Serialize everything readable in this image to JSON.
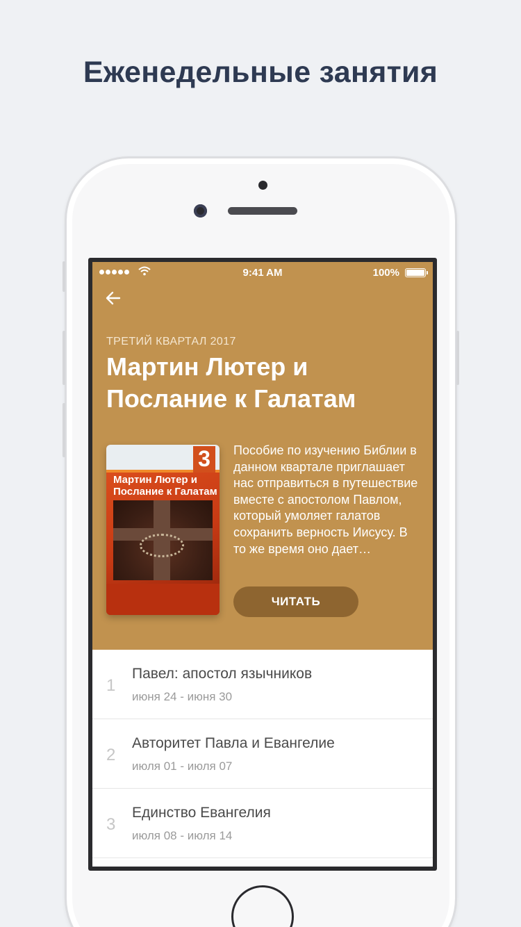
{
  "headline": "Еженедельные занятия",
  "status_bar": {
    "time": "9:41 AM",
    "battery": "100%"
  },
  "quarterly": {
    "quarter": "ТРЕТИЙ КВАРТАЛ 2017",
    "title": "Мартин Лютер и Послание к Галатам",
    "description": "Пособие по изучению Библии в данном квартале приглашает нас отправиться в путешествие вместе с апостолом Павлом, который умоляет галатов сохранить верность Иисусу. В то же время оно дает…",
    "read_label": "ЧИТАТЬ",
    "cover": {
      "number": "3",
      "title": "Мартин Лютер и Послание к Галатам"
    }
  },
  "lessons": [
    {
      "num": "1",
      "title": "Павел: апостол язычников",
      "dates": "июня 24 - июня 30"
    },
    {
      "num": "2",
      "title": "Авторитет Павла и Евангелие",
      "dates": "июля 01 - июля 07"
    },
    {
      "num": "3",
      "title": "Единство Евангелия",
      "dates": "июля 08 - июля 14"
    }
  ],
  "colors": {
    "hero": "#c1924f",
    "button": "#8e6530",
    "headline": "#2e3a52"
  },
  "icons": {
    "back": "arrow-left-icon",
    "wifi": "wifi-icon",
    "battery": "battery-icon"
  }
}
